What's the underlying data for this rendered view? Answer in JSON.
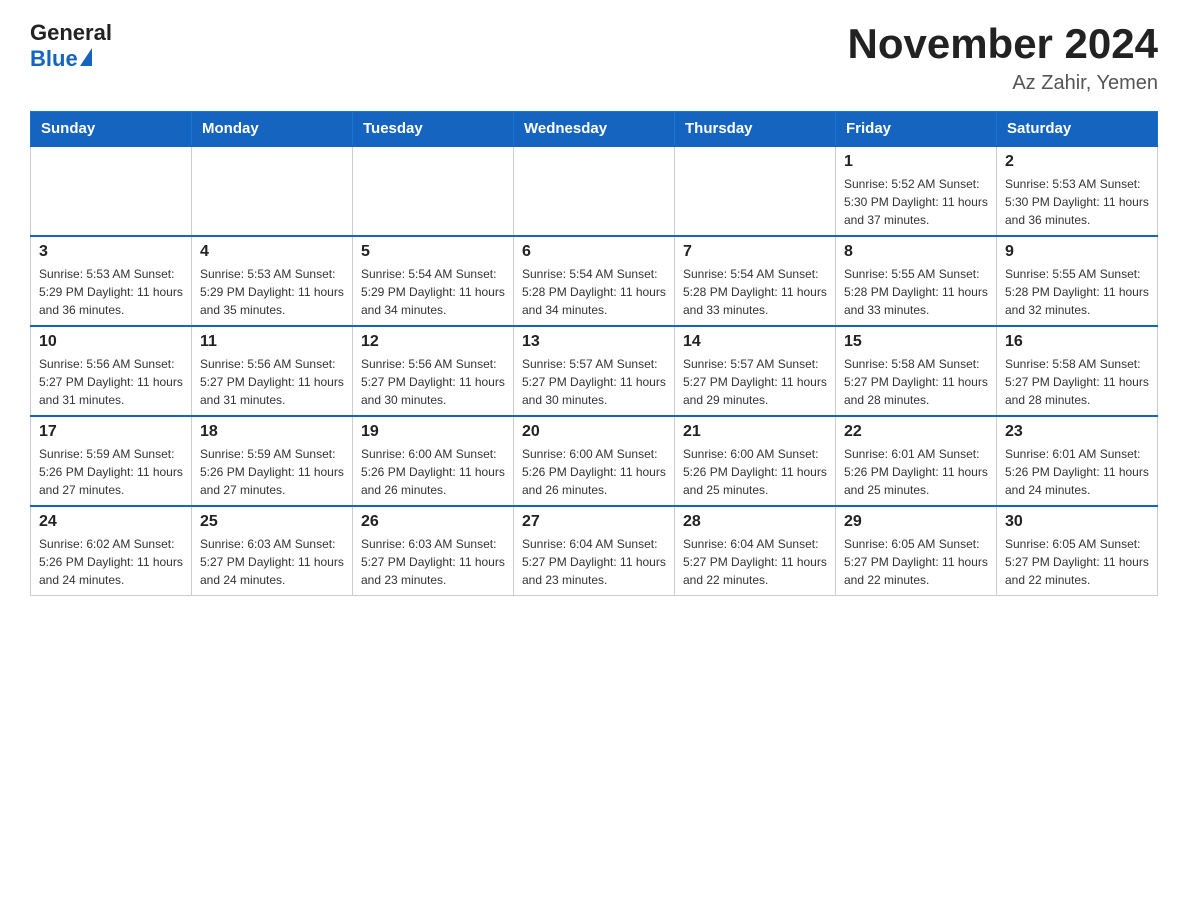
{
  "header": {
    "logo_general": "General",
    "logo_blue": "Blue",
    "main_title": "November 2024",
    "subtitle": "Az Zahir, Yemen"
  },
  "weekdays": [
    "Sunday",
    "Monday",
    "Tuesday",
    "Wednesday",
    "Thursday",
    "Friday",
    "Saturday"
  ],
  "weeks": [
    [
      {
        "day": "",
        "info": ""
      },
      {
        "day": "",
        "info": ""
      },
      {
        "day": "",
        "info": ""
      },
      {
        "day": "",
        "info": ""
      },
      {
        "day": "",
        "info": ""
      },
      {
        "day": "1",
        "info": "Sunrise: 5:52 AM\nSunset: 5:30 PM\nDaylight: 11 hours and 37 minutes."
      },
      {
        "day": "2",
        "info": "Sunrise: 5:53 AM\nSunset: 5:30 PM\nDaylight: 11 hours and 36 minutes."
      }
    ],
    [
      {
        "day": "3",
        "info": "Sunrise: 5:53 AM\nSunset: 5:29 PM\nDaylight: 11 hours and 36 minutes."
      },
      {
        "day": "4",
        "info": "Sunrise: 5:53 AM\nSunset: 5:29 PM\nDaylight: 11 hours and 35 minutes."
      },
      {
        "day": "5",
        "info": "Sunrise: 5:54 AM\nSunset: 5:29 PM\nDaylight: 11 hours and 34 minutes."
      },
      {
        "day": "6",
        "info": "Sunrise: 5:54 AM\nSunset: 5:28 PM\nDaylight: 11 hours and 34 minutes."
      },
      {
        "day": "7",
        "info": "Sunrise: 5:54 AM\nSunset: 5:28 PM\nDaylight: 11 hours and 33 minutes."
      },
      {
        "day": "8",
        "info": "Sunrise: 5:55 AM\nSunset: 5:28 PM\nDaylight: 11 hours and 33 minutes."
      },
      {
        "day": "9",
        "info": "Sunrise: 5:55 AM\nSunset: 5:28 PM\nDaylight: 11 hours and 32 minutes."
      }
    ],
    [
      {
        "day": "10",
        "info": "Sunrise: 5:56 AM\nSunset: 5:27 PM\nDaylight: 11 hours and 31 minutes."
      },
      {
        "day": "11",
        "info": "Sunrise: 5:56 AM\nSunset: 5:27 PM\nDaylight: 11 hours and 31 minutes."
      },
      {
        "day": "12",
        "info": "Sunrise: 5:56 AM\nSunset: 5:27 PM\nDaylight: 11 hours and 30 minutes."
      },
      {
        "day": "13",
        "info": "Sunrise: 5:57 AM\nSunset: 5:27 PM\nDaylight: 11 hours and 30 minutes."
      },
      {
        "day": "14",
        "info": "Sunrise: 5:57 AM\nSunset: 5:27 PM\nDaylight: 11 hours and 29 minutes."
      },
      {
        "day": "15",
        "info": "Sunrise: 5:58 AM\nSunset: 5:27 PM\nDaylight: 11 hours and 28 minutes."
      },
      {
        "day": "16",
        "info": "Sunrise: 5:58 AM\nSunset: 5:27 PM\nDaylight: 11 hours and 28 minutes."
      }
    ],
    [
      {
        "day": "17",
        "info": "Sunrise: 5:59 AM\nSunset: 5:26 PM\nDaylight: 11 hours and 27 minutes."
      },
      {
        "day": "18",
        "info": "Sunrise: 5:59 AM\nSunset: 5:26 PM\nDaylight: 11 hours and 27 minutes."
      },
      {
        "day": "19",
        "info": "Sunrise: 6:00 AM\nSunset: 5:26 PM\nDaylight: 11 hours and 26 minutes."
      },
      {
        "day": "20",
        "info": "Sunrise: 6:00 AM\nSunset: 5:26 PM\nDaylight: 11 hours and 26 minutes."
      },
      {
        "day": "21",
        "info": "Sunrise: 6:00 AM\nSunset: 5:26 PM\nDaylight: 11 hours and 25 minutes."
      },
      {
        "day": "22",
        "info": "Sunrise: 6:01 AM\nSunset: 5:26 PM\nDaylight: 11 hours and 25 minutes."
      },
      {
        "day": "23",
        "info": "Sunrise: 6:01 AM\nSunset: 5:26 PM\nDaylight: 11 hours and 24 minutes."
      }
    ],
    [
      {
        "day": "24",
        "info": "Sunrise: 6:02 AM\nSunset: 5:26 PM\nDaylight: 11 hours and 24 minutes."
      },
      {
        "day": "25",
        "info": "Sunrise: 6:03 AM\nSunset: 5:27 PM\nDaylight: 11 hours and 24 minutes."
      },
      {
        "day": "26",
        "info": "Sunrise: 6:03 AM\nSunset: 5:27 PM\nDaylight: 11 hours and 23 minutes."
      },
      {
        "day": "27",
        "info": "Sunrise: 6:04 AM\nSunset: 5:27 PM\nDaylight: 11 hours and 23 minutes."
      },
      {
        "day": "28",
        "info": "Sunrise: 6:04 AM\nSunset: 5:27 PM\nDaylight: 11 hours and 22 minutes."
      },
      {
        "day": "29",
        "info": "Sunrise: 6:05 AM\nSunset: 5:27 PM\nDaylight: 11 hours and 22 minutes."
      },
      {
        "day": "30",
        "info": "Sunrise: 6:05 AM\nSunset: 5:27 PM\nDaylight: 11 hours and 22 minutes."
      }
    ]
  ]
}
